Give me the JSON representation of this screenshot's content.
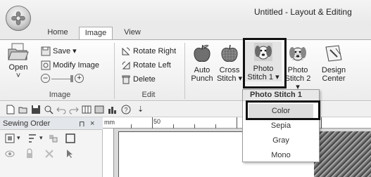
{
  "window": {
    "title": "Untitled - Layout & Editing"
  },
  "tabs": [
    {
      "label": "Home",
      "active": false
    },
    {
      "label": "Image",
      "active": true
    },
    {
      "label": "View",
      "active": false
    }
  ],
  "ribbon": {
    "image_group": {
      "label": "Image",
      "open_label": "Open",
      "save_label": "Save",
      "modify_label": "Modify Image"
    },
    "edit_group": {
      "label": "Edit",
      "rotate_right": "Rotate Right",
      "rotate_left": "Rotate Left",
      "delete": "Delete"
    },
    "stitch_group": {
      "auto_punch": [
        "Auto",
        "Punch"
      ],
      "cross_stitch": [
        "Cross",
        "Stitch"
      ],
      "photo_stitch_1": [
        "Photo",
        "Stitch 1"
      ],
      "photo_stitch_2": [
        "Photo",
        "Stitch 2"
      ],
      "design_center": [
        "Design",
        "Center"
      ]
    }
  },
  "dropdown": {
    "header": "Photo Stitch 1",
    "items": [
      {
        "label": "Color",
        "selected": true
      },
      {
        "label": "Sepia",
        "selected": false
      },
      {
        "label": "Gray",
        "selected": false
      },
      {
        "label": "Mono",
        "selected": false
      }
    ]
  },
  "sewing_order": {
    "title": "Sewing Order",
    "pin_glyph": "⊓",
    "close_glyph": "×"
  },
  "ruler": {
    "mark_50": "50",
    "unit": "mm"
  },
  "colors": {
    "highlight_border": "#111111",
    "ribbon_bg": "#ececec",
    "selected_item": "#dcdcdc"
  },
  "icons": [
    "app-orb-icon",
    "open-folder-icon",
    "save-icon",
    "modify-image-icon",
    "rotate-right-icon",
    "rotate-left-icon",
    "delete-icon",
    "apple-icon",
    "dog-icon",
    "design-center-icon"
  ]
}
